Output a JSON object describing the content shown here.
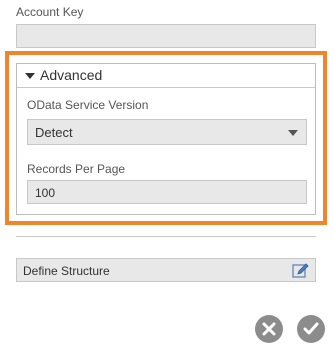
{
  "account_key": {
    "label": "Account Key",
    "value": ""
  },
  "advanced": {
    "title": "Advanced",
    "odata_version": {
      "label": "OData Service Version",
      "selected": "Detect"
    },
    "records_per_page": {
      "label": "Records Per Page",
      "value": "100"
    }
  },
  "define_structure": {
    "label": "Define Structure"
  },
  "colors": {
    "highlight": "#f0852b",
    "field_bg": "#e8e8e8",
    "button_bg": "#8c8c8c"
  },
  "icons": {
    "collapse": "triangle-down-icon",
    "dropdown": "chevron-down-icon",
    "edit": "edit-pencil-icon",
    "cancel": "close-icon",
    "confirm": "check-icon"
  }
}
